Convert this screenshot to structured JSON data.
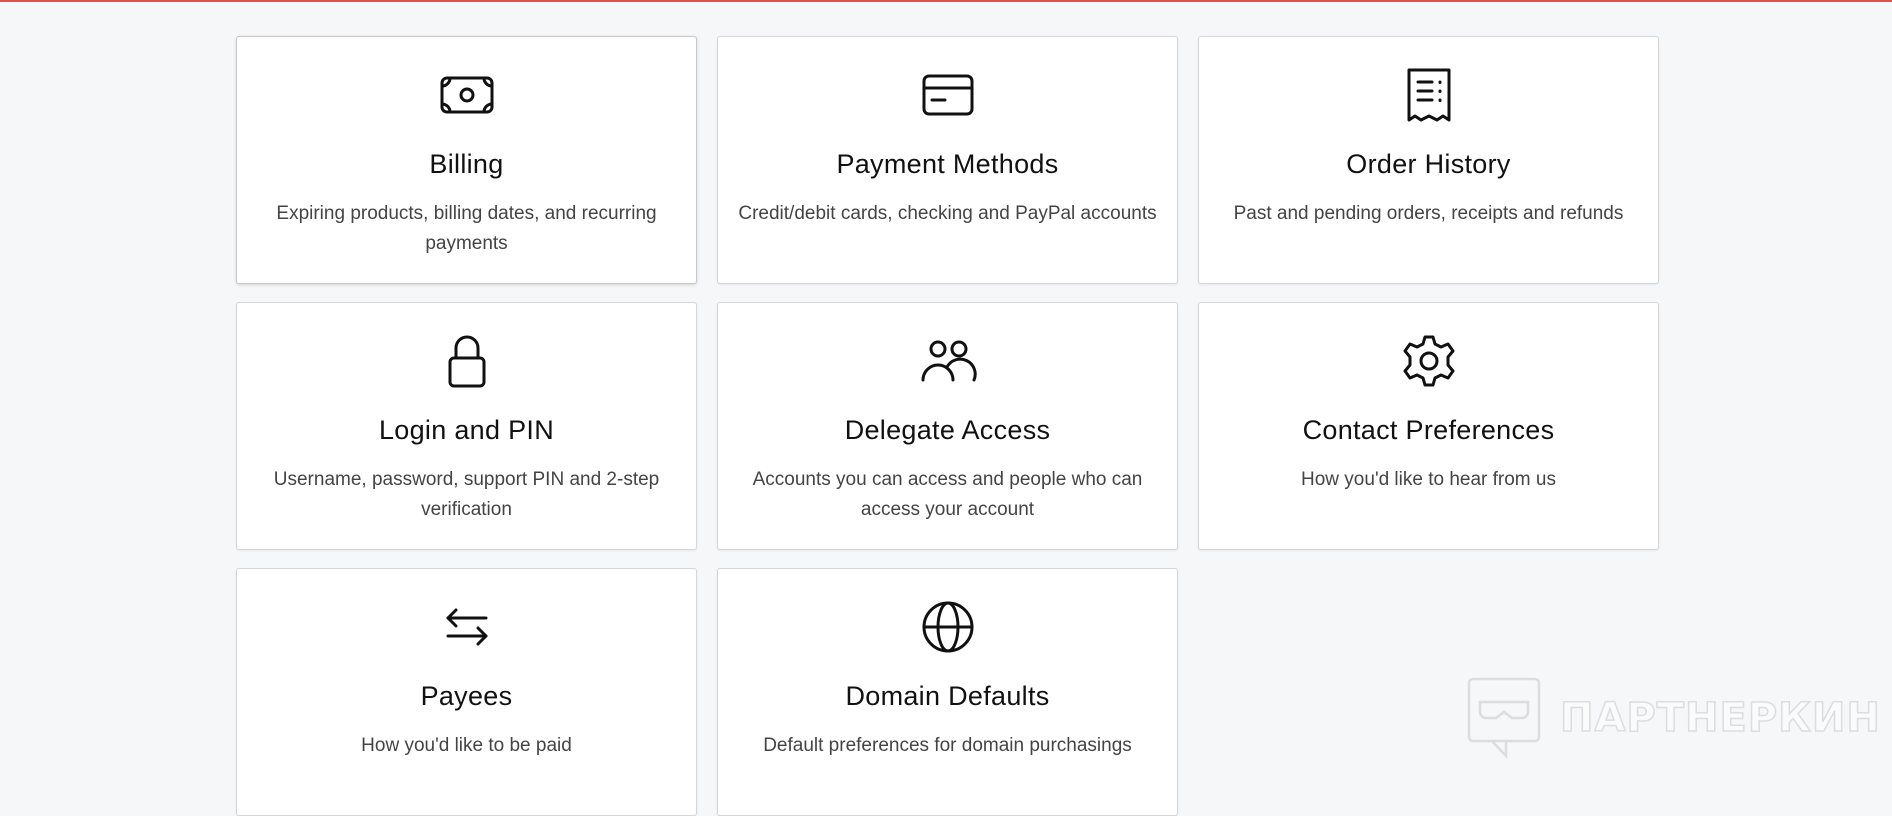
{
  "cards": [
    {
      "title": "Billing",
      "desc": "Expiring products, billing dates, and recurring payments",
      "icon": "money-icon"
    },
    {
      "title": "Payment Methods",
      "desc": "Credit/debit cards, checking and PayPal accounts",
      "icon": "credit-card-icon"
    },
    {
      "title": "Order History",
      "desc": "Past and pending orders, receipts and refunds",
      "icon": "receipt-icon"
    },
    {
      "title": "Login and PIN",
      "desc": "Username, password, support PIN and 2-step verification",
      "icon": "lock-icon"
    },
    {
      "title": "Delegate Access",
      "desc": "Accounts you can access and people who can access your account",
      "icon": "people-icon"
    },
    {
      "title": "Contact Preferences",
      "desc": "How you'd like to hear from us",
      "icon": "gear-icon"
    },
    {
      "title": "Payees",
      "desc": "How you'd like to be paid",
      "icon": "transfer-arrows-icon"
    },
    {
      "title": "Domain Defaults",
      "desc": "Default preferences for domain purchasings",
      "icon": "globe-icon"
    }
  ],
  "watermark": {
    "text": "ПАРТНЕРКИН",
    "icon": "chat-mask-icon"
  },
  "colors": {
    "background": "#f5f7f8",
    "top_rule": "#d9534f",
    "card": "#ffffff"
  }
}
